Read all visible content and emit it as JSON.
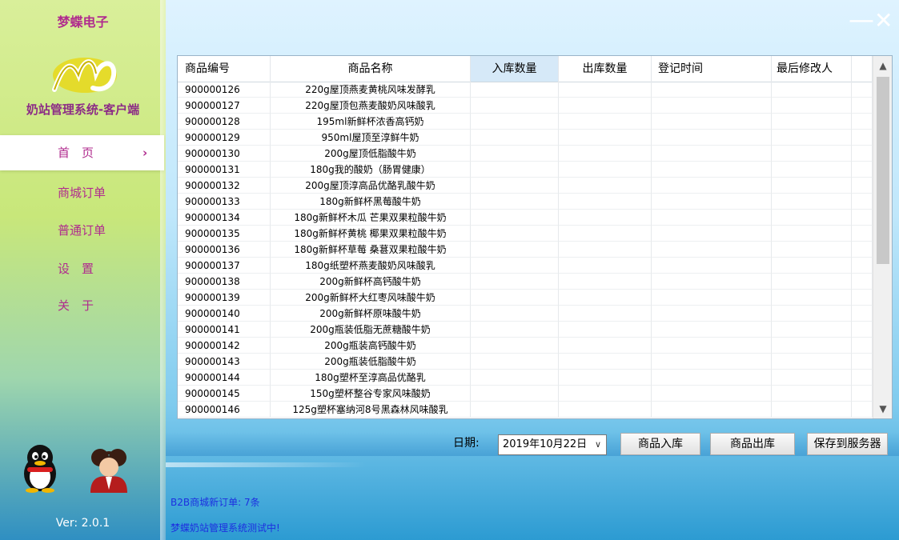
{
  "brand": {
    "company": "梦蝶电子",
    "app_title": "奶站管理系统-客户端",
    "version": "Ver: 2.0.1"
  },
  "nav": {
    "items": [
      {
        "label": "首　页",
        "active": true,
        "chevron": "›"
      },
      {
        "label": "商城订单"
      },
      {
        "label": "普通订单"
      },
      {
        "label": "设　置"
      },
      {
        "label": "关　于"
      }
    ]
  },
  "window": {
    "minimize": "—",
    "close": "✕"
  },
  "table": {
    "columns": [
      "商品编号",
      "商品名称",
      "入库数量",
      "出库数量",
      "登记时间",
      "最后修改人"
    ],
    "rows": [
      [
        "900000126",
        "220g屋顶燕麦黄桃风味发酵乳"
      ],
      [
        "900000127",
        "220g屋顶包燕麦酸奶风味酸乳"
      ],
      [
        "900000128",
        "195ml新鲜杯浓香高钙奶"
      ],
      [
        "900000129",
        "950ml屋顶至淳鲜牛奶"
      ],
      [
        "900000130",
        "200g屋顶低脂酸牛奶"
      ],
      [
        "900000131",
        "180g我的酸奶（肠胃健康）"
      ],
      [
        "900000132",
        "200g屋顶淳高品优酪乳酸牛奶"
      ],
      [
        "900000133",
        "180g新鲜杯黑莓酸牛奶"
      ],
      [
        "900000134",
        "180g新鲜杯木瓜 芒果双果粒酸牛奶"
      ],
      [
        "900000135",
        "180g新鲜杯黄桃 椰果双果粒酸牛奶"
      ],
      [
        "900000136",
        "180g新鲜杯草莓 桑葚双果粒酸牛奶"
      ],
      [
        "900000137",
        "180g纸塑杯燕麦酸奶风味酸乳"
      ],
      [
        "900000138",
        "200g新鲜杯高钙酸牛奶"
      ],
      [
        "900000139",
        "200g新鲜杯大红枣风味酸牛奶"
      ],
      [
        "900000140",
        "200g新鲜杯原味酸牛奶"
      ],
      [
        "900000141",
        "200g瓶装低脂无蔗糖酸牛奶"
      ],
      [
        "900000142",
        "200g瓶装高钙酸牛奶"
      ],
      [
        "900000143",
        "200g瓶装低脂酸牛奶"
      ],
      [
        "900000144",
        "180g塑杯至淳高品优酪乳"
      ],
      [
        "900000145",
        "150g塑杯整谷专家风味酸奶"
      ],
      [
        "900000146",
        "125g塑杯塞纳河8号黑森林风味酸乳"
      ]
    ]
  },
  "controls": {
    "date_label": "日期:",
    "date_value": "2019年10月22日",
    "stock_in": "商品入库",
    "stock_out": "商品出库",
    "save_server": "保存到服务器"
  },
  "status": {
    "new_orders": "B2B商城新订单: 7条",
    "testing": "梦蝶奶站管理系统测试中!"
  },
  "colors": {
    "accent": "#b02b8e",
    "status_text": "#1d2fe0"
  }
}
